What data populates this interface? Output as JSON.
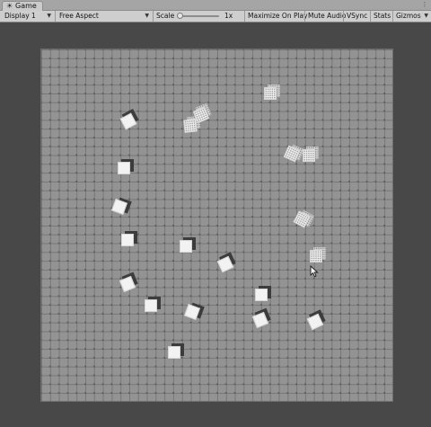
{
  "tab": {
    "title": "Game",
    "icon": "game-controller-icon"
  },
  "toolbar": {
    "display": "Display 1",
    "aspect": "Free Aspect",
    "scale_label": "Scale",
    "scale_value": "1x",
    "scale_level": 0,
    "maximize_on_play": "Maximize On Play",
    "mute_audio": "Mute Audio",
    "vsync": "VSync",
    "stats": "Stats",
    "gizmos": "Gizmos"
  },
  "colors": {
    "floor": "#939393",
    "grid_line": "#767676",
    "background": "#484848",
    "toolbar": "#cecece"
  },
  "cursor": "arrow-cursor-icon"
}
